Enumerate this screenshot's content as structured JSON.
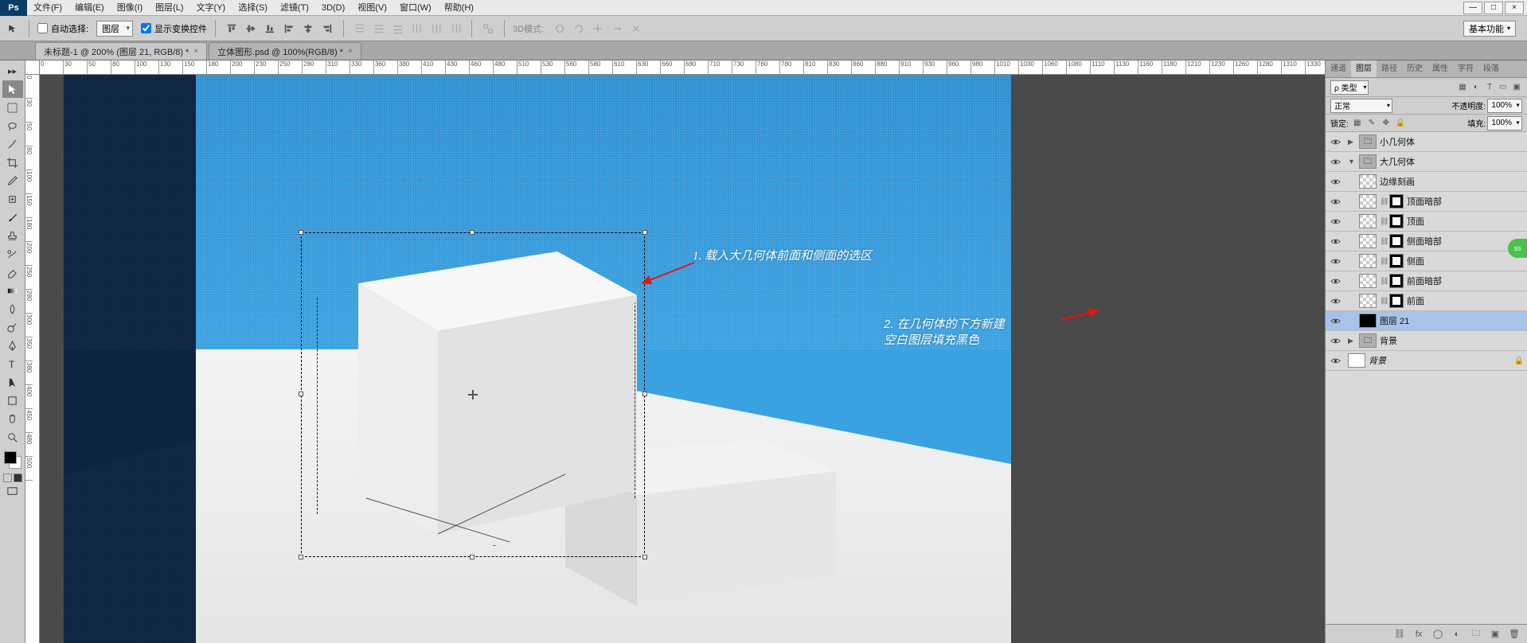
{
  "app_logo": "Ps",
  "menu": [
    "文件(F)",
    "编辑(E)",
    "图像(I)",
    "图层(L)",
    "文字(Y)",
    "选择(S)",
    "滤镜(T)",
    "3D(D)",
    "视图(V)",
    "窗口(W)",
    "帮助(H)"
  ],
  "win_ctrl": {
    "min": "—",
    "max": "□",
    "close": "×"
  },
  "options": {
    "auto_select_label": "自动选择:",
    "target_dropdown": "图层",
    "show_transform": "显示变换控件",
    "mode3d_label": "3D模式:",
    "workspace": "基本功能"
  },
  "tabs": [
    {
      "title": "未标题-1 @ 200% (图层 21, RGB/8) *"
    },
    {
      "title": "立体图形.psd @ 100%(RGB/8) *"
    }
  ],
  "ruler_h": [
    "0",
    "30",
    "50",
    "80",
    "100",
    "130",
    "150",
    "180",
    "200",
    "230",
    "250",
    "280",
    "310",
    "330",
    "360",
    "380",
    "410",
    "430",
    "460",
    "480",
    "510",
    "530",
    "560",
    "580",
    "610",
    "630",
    "660",
    "680",
    "710",
    "730",
    "760",
    "780",
    "810",
    "830",
    "860",
    "880",
    "910",
    "930",
    "960",
    "980",
    "1010",
    "1030",
    "1060",
    "1080",
    "1110",
    "1130",
    "1160",
    "1180",
    "1210",
    "1230",
    "1260",
    "1280",
    "1310",
    "1330"
  ],
  "ruler_v": [
    "0",
    "30",
    "50",
    "80",
    "100",
    "150",
    "180",
    "200",
    "250",
    "280",
    "300",
    "350",
    "380",
    "400",
    "450",
    "480",
    "500"
  ],
  "annotations": {
    "a1": "1. 载入大几何体前面和侧面的选区",
    "a2_l1": "2. 在几何体的下方新建",
    "a2_l2": "空白图层填充黑色"
  },
  "panels": {
    "tabs": [
      "通道",
      "图层",
      "路径",
      "历史",
      "属性",
      "字符",
      "段落"
    ],
    "active_tab": "图层",
    "kind_label": "ρ 类型",
    "blend_mode": "正常",
    "opacity_label": "不透明度:",
    "opacity_value": "100%",
    "lock_label": "锁定:",
    "fill_label": "填充:",
    "fill_value": "100%"
  },
  "layers": [
    {
      "indent": 0,
      "type": "group",
      "twisty": "▶",
      "name": "小几何体",
      "vis": true
    },
    {
      "indent": 0,
      "type": "group",
      "twisty": "▼",
      "name": "大几何体",
      "vis": true
    },
    {
      "indent": 1,
      "type": "layer",
      "thumb": "trans",
      "name": "边缘刻画",
      "vis": true
    },
    {
      "indent": 1,
      "type": "masked",
      "thumb": "trans",
      "name": "顶面暗部",
      "vis": true
    },
    {
      "indent": 1,
      "type": "masked",
      "thumb": "trans",
      "name": "顶面",
      "vis": true
    },
    {
      "indent": 1,
      "type": "masked",
      "thumb": "trans",
      "name": "侧面暗部",
      "vis": true
    },
    {
      "indent": 1,
      "type": "masked",
      "thumb": "trans",
      "name": "侧面",
      "vis": true
    },
    {
      "indent": 1,
      "type": "masked",
      "thumb": "trans",
      "name": "前面暗部",
      "vis": true
    },
    {
      "indent": 1,
      "type": "masked",
      "thumb": "trans",
      "name": "前面",
      "vis": true
    },
    {
      "indent": 1,
      "type": "layer",
      "thumb": "black",
      "name": "图层 21",
      "vis": true,
      "selected": true
    },
    {
      "indent": 0,
      "type": "group",
      "twisty": "▶",
      "name": "背景",
      "vis": true
    },
    {
      "indent": 0,
      "type": "bg",
      "thumb": "white",
      "name": "背景",
      "vis": true,
      "italic": true,
      "locked": true
    }
  ],
  "side_badge": "ss"
}
